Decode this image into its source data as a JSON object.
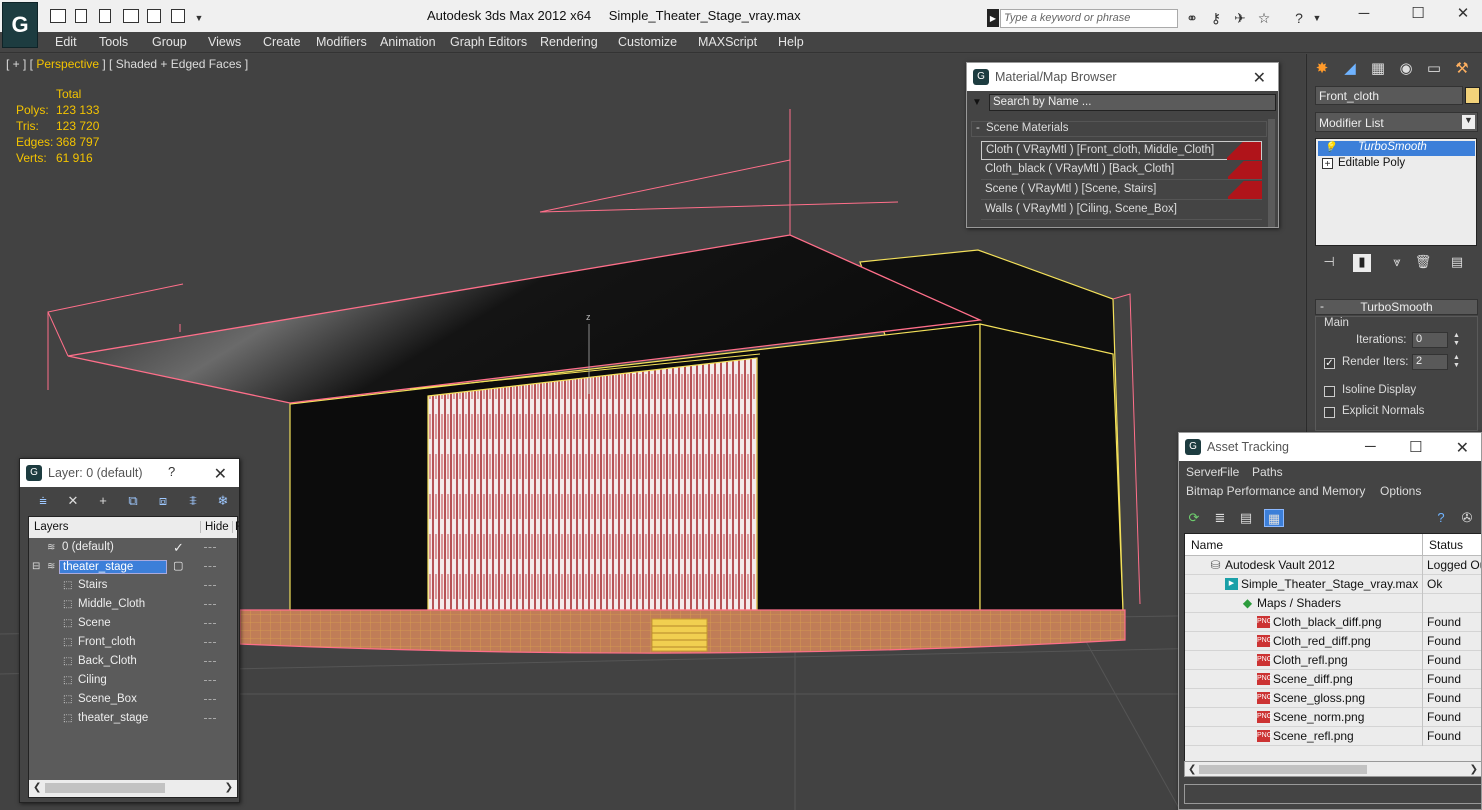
{
  "app": {
    "title": "Autodesk 3ds Max  2012 x64",
    "file": "Simple_Theater_Stage_vray.max",
    "search_placeholder": "Type a keyword or phrase",
    "logo_glyph": "G"
  },
  "menu": [
    "Edit",
    "Tools",
    "Group",
    "Views",
    "Create",
    "Modifiers",
    "Animation",
    "Graph Editors",
    "Rendering",
    "Customize",
    "MAXScript",
    "Help"
  ],
  "viewport": {
    "label_prefix": "[ + ] [",
    "label_view": " Perspective ",
    "label_suffix": "] [ Shaded + Edged Faces ]",
    "stats_header": "Total",
    "stats": [
      {
        "k": "Polys:",
        "v": "123 133"
      },
      {
        "k": "Tris:",
        "v": "123 720"
      },
      {
        "k": "Edges:",
        "v": "368 797"
      },
      {
        "k": "Verts:",
        "v": "61 916"
      }
    ],
    "axis_label": "z"
  },
  "command_panel": {
    "object_name": "Front_cloth",
    "object_color": "#f2d27a",
    "modifier_list": "Modifier List",
    "stack": [
      {
        "label": "TurboSmooth",
        "selected": true
      },
      {
        "label": "Editable Poly",
        "selected": false
      }
    ],
    "rollout_title": "TurboSmooth",
    "main_label": "Main",
    "iterations_label": "Iterations:",
    "iterations_value": "0",
    "render_iters_label": "Render Iters:",
    "render_iters_value": "2",
    "isoline_label": "Isoline Display",
    "explicit_label": "Explicit Normals"
  },
  "material_browser": {
    "title": "Material/Map Browser",
    "search_placeholder": "Search by Name ...",
    "group": "Scene Materials",
    "items": [
      "Cloth  ( VRayMtl ) [Front_cloth, Middle_Cloth]",
      "Cloth_black  ( VRayMtl ) [Back_Cloth]",
      "Scene  ( VRayMtl ) [Scene, Stairs]",
      "Walls  ( VRayMtl ) [Ciling, Scene_Box]"
    ]
  },
  "layers": {
    "title": "Layer: 0 (default)",
    "col_layers": "Layers",
    "col_hide": "Hide",
    "col_freeze": "F",
    "rows": [
      {
        "name": "0 (default)",
        "indent": 1,
        "checked": true
      },
      {
        "name": "theater_stage",
        "indent": 1,
        "selected": true
      },
      {
        "name": "Stairs",
        "indent": 2
      },
      {
        "name": "Middle_Cloth",
        "indent": 2
      },
      {
        "name": "Scene",
        "indent": 2
      },
      {
        "name": "Front_cloth",
        "indent": 2
      },
      {
        "name": "Back_Cloth",
        "indent": 2
      },
      {
        "name": "Ciling",
        "indent": 2
      },
      {
        "name": "Scene_Box",
        "indent": 2
      },
      {
        "name": "theater_stage",
        "indent": 2
      }
    ]
  },
  "asset_tracking": {
    "title": "Asset Tracking",
    "menu1": [
      "Server",
      "File",
      "Paths"
    ],
    "menu2": [
      "Bitmap Performance and Memory",
      "Options"
    ],
    "col_name": "Name",
    "col_status": "Status",
    "rows": [
      {
        "name": "Autodesk Vault 2012",
        "status": "Logged Out",
        "icon": "vault-icon",
        "indent": 0
      },
      {
        "name": "Simple_Theater_Stage_vray.max",
        "status": "Ok",
        "icon": "max-file-icon",
        "indent": 1
      },
      {
        "name": "Maps / Shaders",
        "status": "",
        "icon": "maps-icon",
        "indent": 2
      },
      {
        "name": "Cloth_black_diff.png",
        "status": "Found",
        "icon": "png-icon",
        "indent": 3
      },
      {
        "name": "Cloth_red_diff.png",
        "status": "Found",
        "icon": "png-icon",
        "indent": 3
      },
      {
        "name": "Cloth_refl.png",
        "status": "Found",
        "icon": "png-icon",
        "indent": 3
      },
      {
        "name": "Scene_diff.png",
        "status": "Found",
        "icon": "png-icon",
        "indent": 3
      },
      {
        "name": "Scene_gloss.png",
        "status": "Found",
        "icon": "png-icon",
        "indent": 3
      },
      {
        "name": "Scene_norm.png",
        "status": "Found",
        "icon": "png-icon",
        "indent": 3
      },
      {
        "name": "Scene_refl.png",
        "status": "Found",
        "icon": "png-icon",
        "indent": 3
      }
    ]
  }
}
